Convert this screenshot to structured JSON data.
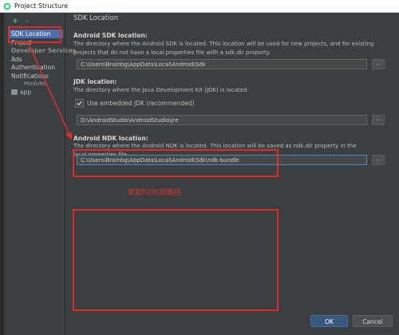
{
  "window": {
    "title": "Project Structure"
  },
  "sidebar": {
    "items": [
      {
        "label": "SDK Location"
      },
      {
        "label": "Project"
      },
      {
        "label": "Developer Services"
      },
      {
        "label": "Ads"
      },
      {
        "label": "Authentication"
      },
      {
        "label": "Notifications"
      }
    ],
    "modules_header": "Modules",
    "modules": [
      {
        "label": "app"
      }
    ],
    "add_label": "+",
    "remove_label": "–"
  },
  "main": {
    "page_title": "SDK Location",
    "sdk": {
      "title": "Android SDK location:",
      "description": "The directory where the Android SDK is located. This location will be used for new projects, and for existing projects that do not have a local.properties file with a sdk.dir property.",
      "value": "C:\\Users\\Brainbg\\AppData\\Local\\Android\\Sdk",
      "browse_label": "..."
    },
    "jdk": {
      "title": "JDK location:",
      "description": "The directory where the Java Development Kit (JDK) is located.",
      "checkbox_label": "Use embedded JDK (recommended)",
      "checkbox_checked": true,
      "value": "D:\\AndroidStudio\\AndroidStudio\\jre",
      "browse_label": "..."
    },
    "ndk": {
      "title": "Android NDK location:",
      "description": "The directory where the Android NDK is located. This location will be saved as ndk.dir property in the local.properties file.",
      "value": "C:\\Users\\Brainbg\\AppData\\Local\\Android\\Sdk\\ndk-bundle",
      "browse_label": "..."
    },
    "annotation": "复制NDK的路径"
  },
  "buttons": {
    "ok": "OK",
    "cancel": "Cancel"
  },
  "colors": {
    "background": "#3c3f41",
    "selection": "#4b6eaf",
    "annotation_red": "#e02b2b",
    "ok_button": "#365880"
  }
}
